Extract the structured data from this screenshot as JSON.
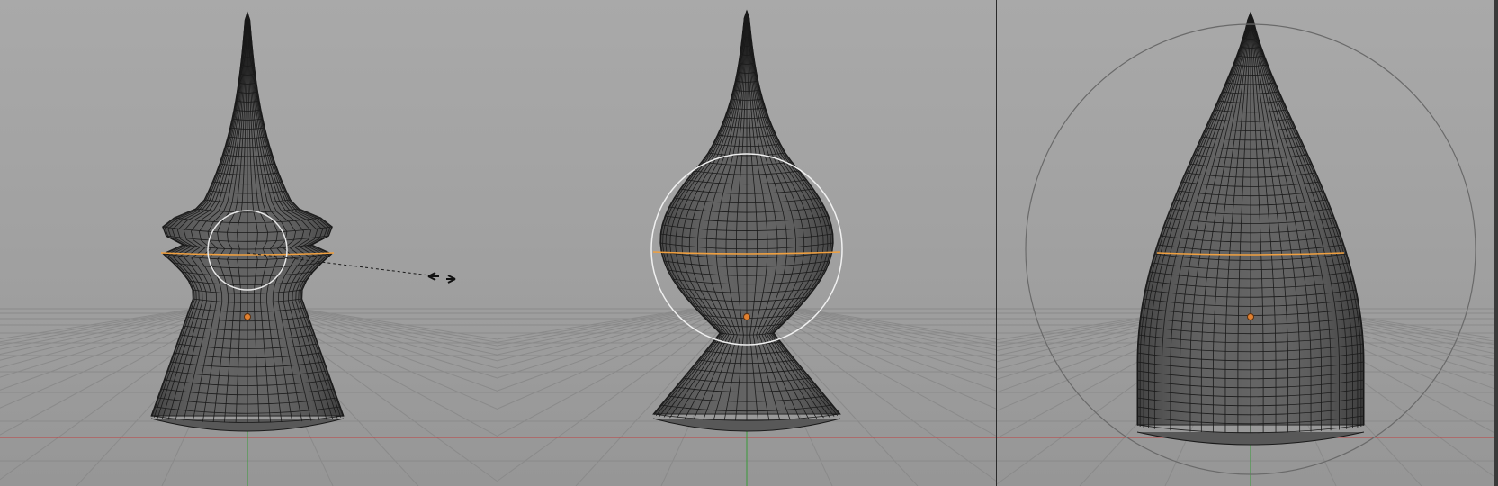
{
  "screen": {
    "type": "3D viewport — proportional editing comparison",
    "viewports": [
      {
        "name": "viewport-left",
        "influence": "small",
        "shape": "spike-knob"
      },
      {
        "name": "viewport-middle",
        "influence": "medium",
        "shape": "bulb"
      },
      {
        "name": "viewport-right",
        "influence": "large",
        "shape": "dome"
      }
    ]
  },
  "colors": {
    "background_top": "#a9a9a9",
    "background_bottom": "#969696",
    "grid": "#8a8a8a",
    "x_axis": "#c04040",
    "y_axis": "#3a9a3a",
    "mesh_fill": "#585858",
    "mesh_wire": "#1a1a1a",
    "selected_loop": "#f0a040",
    "origin": "#e08030",
    "influence_circle_left": "#e8e8e8",
    "influence_circle_mid": "#f0f0f0",
    "influence_circle_right": "#6a6a6a"
  },
  "icons": {
    "proportional_cursor": "double-arrow-cursor-icon"
  }
}
